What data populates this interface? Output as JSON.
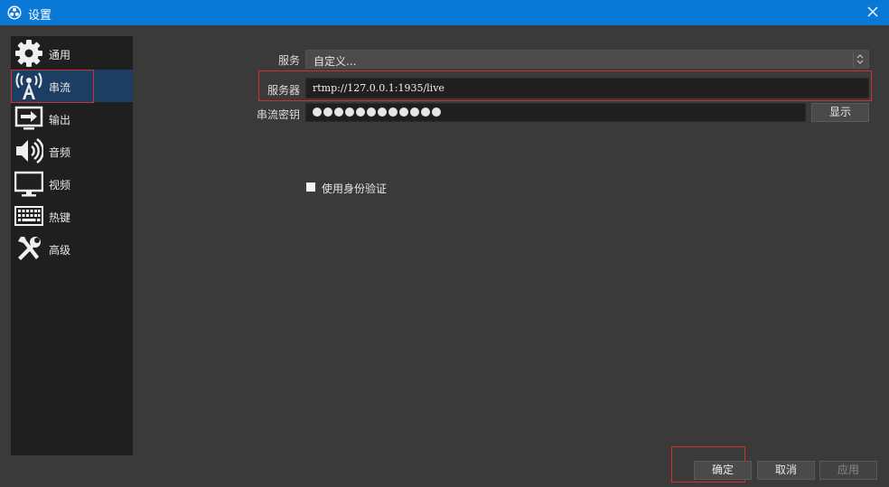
{
  "window": {
    "title": "设置"
  },
  "sidebar": {
    "items": [
      {
        "label": "通用",
        "icon": "gear-icon"
      },
      {
        "label": "串流",
        "icon": "broadcast-tower-icon"
      },
      {
        "label": "输出",
        "icon": "output-icon"
      },
      {
        "label": "音频",
        "icon": "speaker-icon"
      },
      {
        "label": "视频",
        "icon": "monitor-icon"
      },
      {
        "label": "热键",
        "icon": "keyboard-icon"
      },
      {
        "label": "高级",
        "icon": "tools-icon"
      }
    ],
    "active_index": 1
  },
  "stream": {
    "service_label": "服务",
    "service_value": "自定义...",
    "server_label": "服务器",
    "server_value": "rtmp://127.0.0.1:1935/live",
    "key_label": "串流密钥",
    "key_masked_length": 12,
    "show_button": "显示",
    "auth_label": "使用身份验证"
  },
  "footer": {
    "ok": "确定",
    "cancel": "取消",
    "apply": "应用"
  },
  "colors": {
    "titlebar": "#0a78d7",
    "active_nav": "#1d3e63",
    "highlight": "#d0312d"
  }
}
